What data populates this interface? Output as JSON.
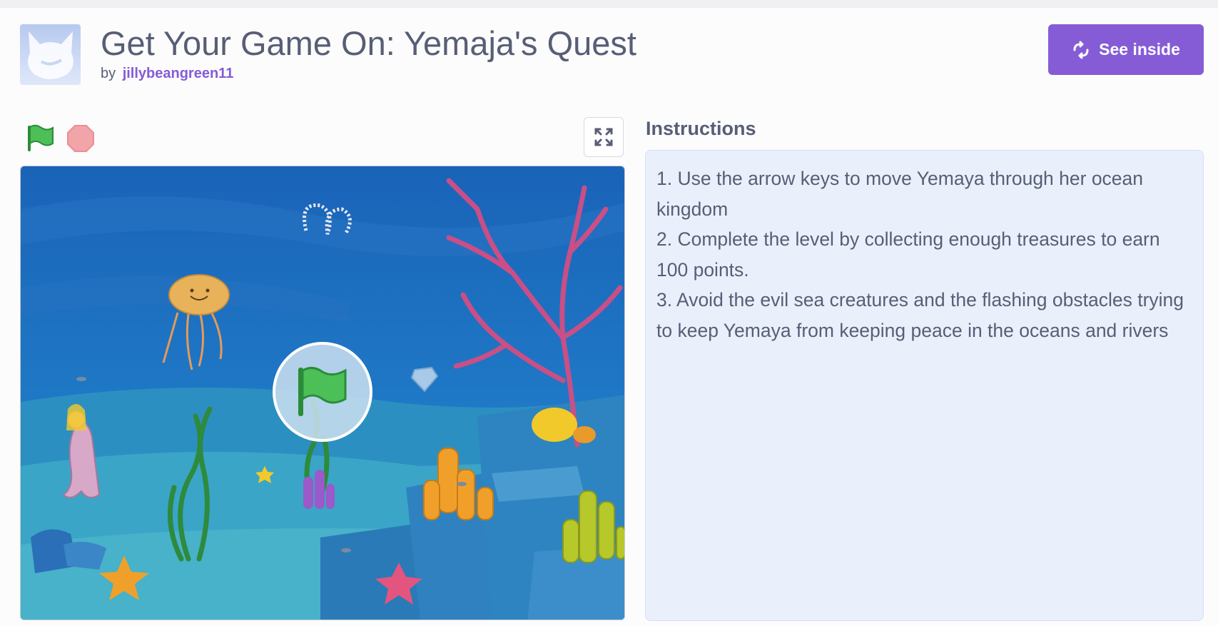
{
  "project": {
    "title": "Get Your Game On: Yemaja's Quest",
    "by_label": "by",
    "author": "jillybeangreen11"
  },
  "header": {
    "see_inside_label": "See inside",
    "accent_color": "#855cd6"
  },
  "player": {
    "controls": {
      "green_flag_icon": "green-flag-icon",
      "stop_icon": "stop-sign-icon",
      "fullscreen_icon": "fullscreen-icon"
    },
    "stage_scene": "underwater scene with mermaid, jellyfish, corals, seaweed, starfish and treasures",
    "overlay_icon": "green-flag-icon"
  },
  "instructions": {
    "heading": "Instructions",
    "lines": [
      "1. Use the arrow keys to move Yemaya through her ocean kingdom",
      "2. Complete the level by collecting enough treasures to earn 100 points.",
      "3. Avoid the evil sea creatures and the flashing obstacles trying to keep Yemaya from keeping peace in the oceans and rivers"
    ]
  }
}
